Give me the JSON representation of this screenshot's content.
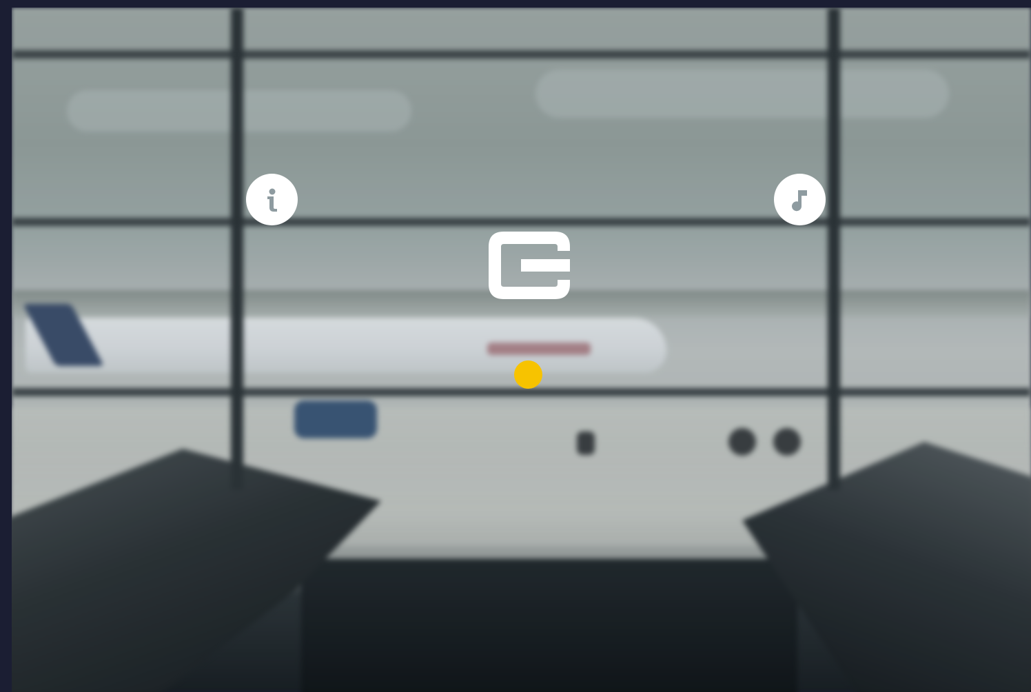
{
  "colors": {
    "frame": "#1b1e33",
    "icon_bg": "#ffffff",
    "icon_glyph": "#8e9ba0",
    "logo": "#ffffff",
    "status_dot": "#f7c300"
  },
  "icons": {
    "info": "info-icon",
    "music": "music-note-icon",
    "logo": "brand-logo"
  },
  "background": "blurred-airport-gate-photo"
}
